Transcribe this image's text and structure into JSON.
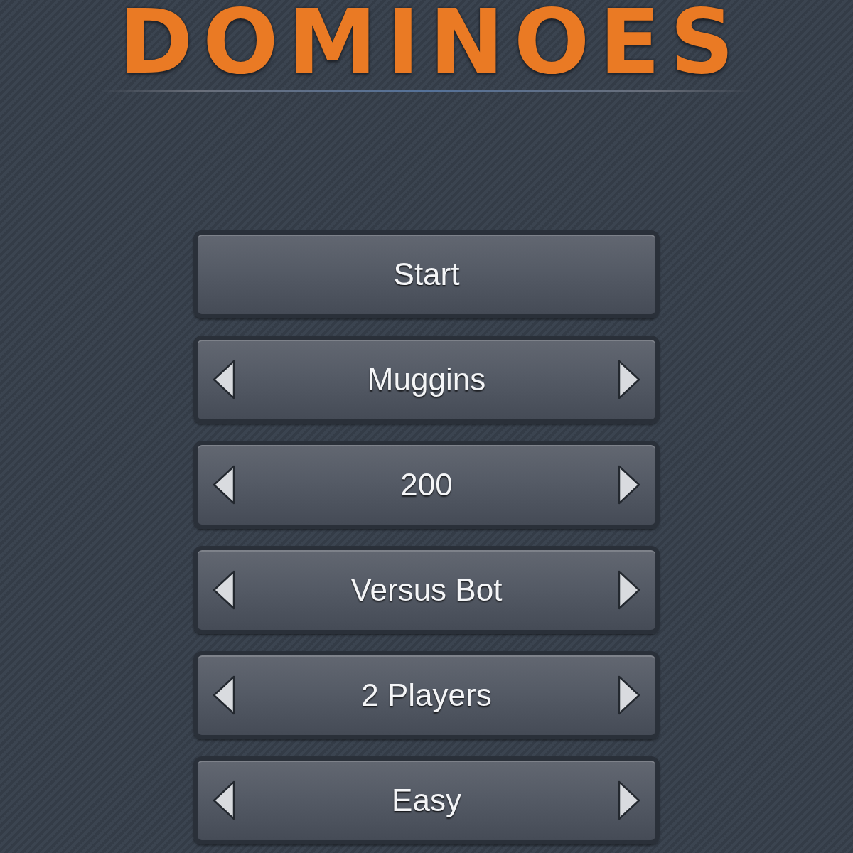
{
  "title": {
    "text": "DOMINOES"
  },
  "menu": [
    {
      "kind": "button",
      "label": "Start"
    },
    {
      "kind": "selector",
      "value": "Muggins"
    },
    {
      "kind": "selector",
      "value": "200"
    },
    {
      "kind": "selector",
      "value": "Versus Bot"
    },
    {
      "kind": "selector",
      "value": "2 Players"
    },
    {
      "kind": "selector",
      "value": "Easy"
    }
  ]
}
